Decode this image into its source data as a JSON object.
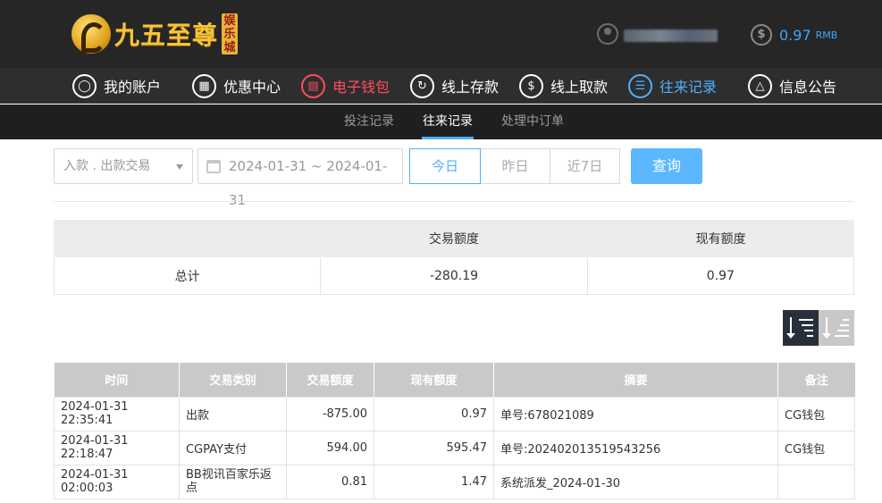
{
  "brand": {
    "name": "九五至尊",
    "badge": "娱乐城"
  },
  "balance": {
    "value": "0.97",
    "unit": "RMB"
  },
  "nav": [
    {
      "label": "我的账户",
      "icon": "user-icon"
    },
    {
      "label": "优惠中心",
      "icon": "gift-icon"
    },
    {
      "label": "电子钱包",
      "icon": "wallet-icon"
    },
    {
      "label": "线上存款",
      "icon": "deposit-icon"
    },
    {
      "label": "线上取款",
      "icon": "withdraw-icon"
    },
    {
      "label": "往来记录",
      "icon": "records-icon"
    },
    {
      "label": "信息公告",
      "icon": "bell-icon"
    }
  ],
  "subnav": [
    {
      "label": "投注记录"
    },
    {
      "label": "往来记录"
    },
    {
      "label": "处理中订单"
    }
  ],
  "filters": {
    "type": "入款 . 出款交易",
    "date_range": "2024-01-31 ~ 2024-01-31",
    "ranges": [
      "今日",
      "昨日",
      "近7日"
    ],
    "query": "查询"
  },
  "summary": {
    "headers": [
      "",
      "交易额度",
      "现有额度"
    ],
    "row": [
      "总计",
      "-280.19",
      "0.97"
    ]
  },
  "records": {
    "headers": [
      "时间",
      "交易类别",
      "交易额度",
      "现有额度",
      "摘要",
      "备注"
    ],
    "rows": [
      [
        "2024-01-31 22:35:41",
        "出款",
        "-875.00",
        "0.97",
        "单号:678021089",
        "CG钱包"
      ],
      [
        "2024-01-31 22:18:47",
        "CGPAY支付",
        "594.00",
        "595.47",
        "单号:202402013519543256",
        "CG钱包"
      ],
      [
        "2024-01-31 02:00:03",
        "BB视讯百家乐返点",
        "0.81",
        "1.47",
        "系统派发_2024-01-30",
        ""
      ]
    ]
  },
  "colors": {
    "accent_blue": "#4fb0ff",
    "accent_red": "#ff4d5e",
    "header_bg": "#262626",
    "query_button": "#5bb8ff"
  }
}
